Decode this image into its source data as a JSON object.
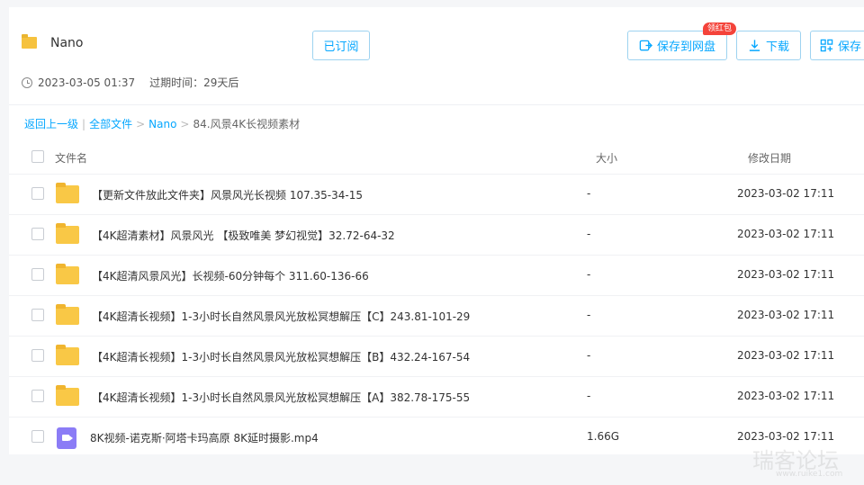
{
  "share": {
    "title": "Nano",
    "date": "2023-03-05 01:37",
    "expire": "过期时间：29天后"
  },
  "toolbar": {
    "subscribe_label": "已订阅",
    "save_label": "保存到网盘",
    "badge_label": "领红包",
    "download_label": "下载",
    "save2_label": "保存"
  },
  "breadcrumb": {
    "back": "返回上一级",
    "all_files": "全部文件",
    "nano": "Nano",
    "current": "84.风景4K长视频素材",
    "sep": "|",
    "arrow": ">"
  },
  "table": {
    "headers": {
      "name": "文件名",
      "size": "大小",
      "date": "修改日期"
    },
    "rows": [
      {
        "name": "【更新文件放此文件夹】风景风光长视频 107.35-34-15",
        "size": "-",
        "date": "2023-03-02 17:11",
        "type": "folder"
      },
      {
        "name": "【4K超清素材】风景风光 【极致唯美 梦幻视觉】32.72-64-32",
        "size": "-",
        "date": "2023-03-02 17:11",
        "type": "folder"
      },
      {
        "name": "【4K超清风景风光】长视频-60分钟每个 311.60-136-66",
        "size": "-",
        "date": "2023-03-02 17:11",
        "type": "folder"
      },
      {
        "name": "【4K超清长视频】1-3小时长自然风景风光放松冥想解压【C】243.81-101-29",
        "size": "-",
        "date": "2023-03-02 17:11",
        "type": "folder"
      },
      {
        "name": "【4K超清长视频】1-3小时长自然风景风光放松冥想解压【B】432.24-167-54",
        "size": "-",
        "date": "2023-03-02 17:11",
        "type": "folder"
      },
      {
        "name": "【4K超清长视频】1-3小时长自然风景风光放松冥想解压【A】382.78-175-55",
        "size": "-",
        "date": "2023-03-02 17:11",
        "type": "folder"
      },
      {
        "name": "8K视频-诺克斯·阿塔卡玛高原 8K延时摄影.mp4",
        "size": "1.66G",
        "date": "2023-03-02 17:11",
        "type": "video"
      }
    ]
  },
  "watermark": {
    "main": "瑞客论坛",
    "sub": "www.ruike1.com"
  },
  "colors": {
    "accent": "#06a7ff",
    "folder": "#f9c846",
    "video": "#8b7cf6",
    "badge": "#f4433a"
  },
  "icons": [
    "folder-icon",
    "clock-icon",
    "save-to-cloud-icon",
    "download-icon",
    "save-icon",
    "video-file-icon"
  ]
}
